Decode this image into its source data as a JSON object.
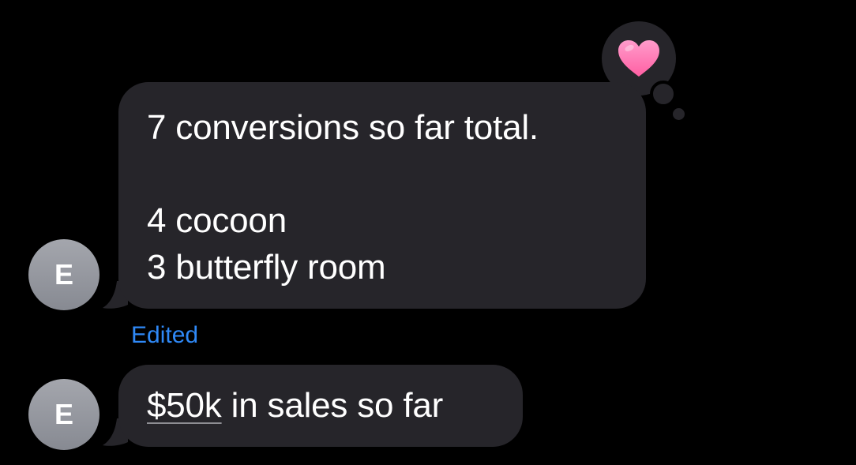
{
  "conversation": {
    "messages": [
      {
        "sender_initial": "E",
        "lines": [
          "7 conversions so far total.",
          "",
          "4 cocoon",
          "3 butterfly room"
        ],
        "reaction": "heart-icon",
        "status": "Edited"
      },
      {
        "sender_initial": "E",
        "link_text": "$50k",
        "text_after_link": " in sales so far"
      }
    ]
  },
  "colors": {
    "background": "#000000",
    "bubble": "#26252a",
    "text": "#ffffff",
    "edited": "#2f89f7",
    "heart": "#ff7eb6"
  }
}
